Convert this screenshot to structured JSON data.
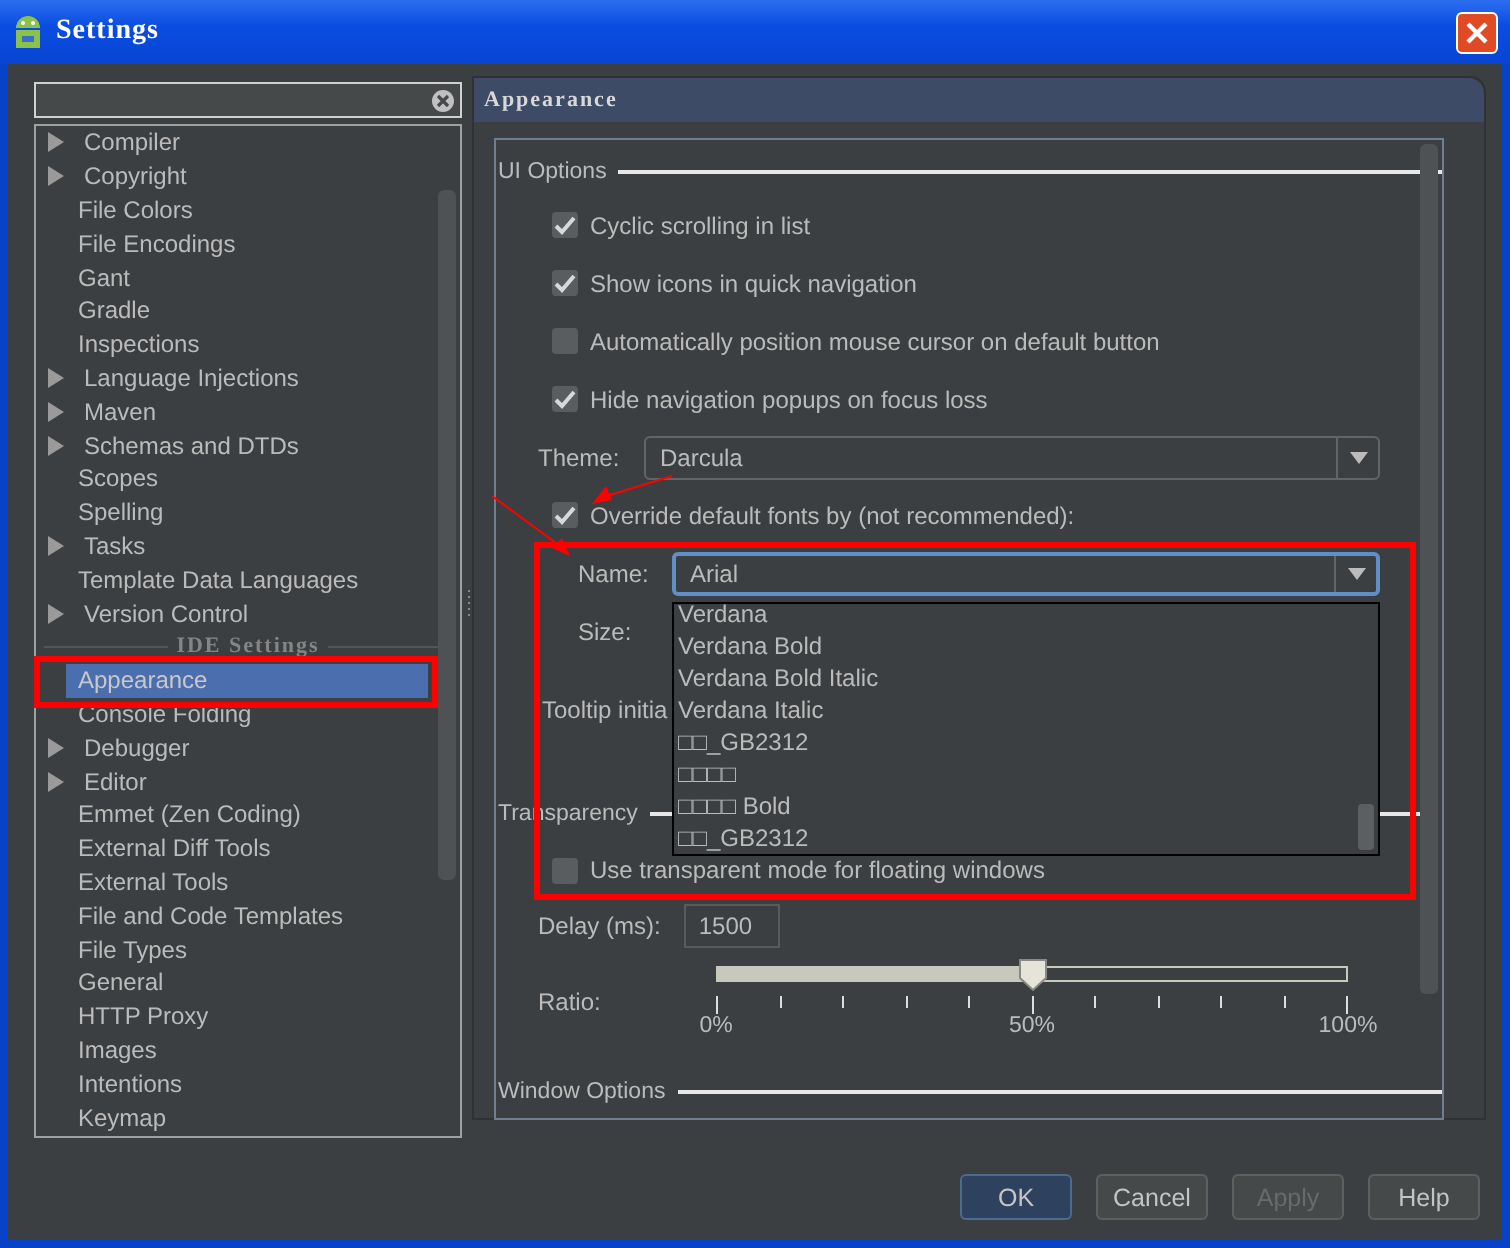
{
  "window": {
    "title": "Settings"
  },
  "tree": [
    {
      "kind": "node",
      "label": "Compiler",
      "selected": false
    },
    {
      "kind": "node",
      "label": "Copyright",
      "selected": false
    },
    {
      "kind": "leaf",
      "label": "File Colors",
      "selected": false
    },
    {
      "kind": "leaf",
      "label": "File Encodings",
      "selected": false
    },
    {
      "kind": "leaf",
      "label": "Gant",
      "selected": false
    },
    {
      "kind": "leaf",
      "label": "Gradle",
      "selected": false
    },
    {
      "kind": "leaf",
      "label": "Inspections",
      "selected": false
    },
    {
      "kind": "node",
      "label": "Language Injections",
      "selected": false
    },
    {
      "kind": "node",
      "label": "Maven",
      "selected": false
    },
    {
      "kind": "node",
      "label": "Schemas and DTDs",
      "selected": false
    },
    {
      "kind": "leaf",
      "label": "Scopes",
      "selected": false
    },
    {
      "kind": "leaf",
      "label": "Spelling",
      "selected": false
    },
    {
      "kind": "node",
      "label": "Tasks",
      "selected": false
    },
    {
      "kind": "leaf",
      "label": "Template Data Languages",
      "selected": false
    },
    {
      "kind": "node",
      "label": "Version Control",
      "selected": false
    },
    {
      "kind": "section",
      "label": "IDE Settings",
      "selected": false
    },
    {
      "kind": "leaf",
      "label": "Appearance",
      "selected": true
    },
    {
      "kind": "leaf",
      "label": "Console Folding",
      "selected": false
    },
    {
      "kind": "node",
      "label": "Debugger",
      "selected": false
    },
    {
      "kind": "node",
      "label": "Editor",
      "selected": false
    },
    {
      "kind": "leaf",
      "label": "Emmet (Zen Coding)",
      "selected": false
    },
    {
      "kind": "leaf",
      "label": "External Diff Tools",
      "selected": false
    },
    {
      "kind": "leaf",
      "label": "External Tools",
      "selected": false
    },
    {
      "kind": "leaf",
      "label": "File and Code Templates",
      "selected": false
    },
    {
      "kind": "leaf",
      "label": "File Types",
      "selected": false
    },
    {
      "kind": "leaf",
      "label": "General",
      "selected": false
    },
    {
      "kind": "leaf",
      "label": "HTTP Proxy",
      "selected": false
    },
    {
      "kind": "leaf",
      "label": "Images",
      "selected": false
    },
    {
      "kind": "leaf",
      "label": "Intentions",
      "selected": false
    },
    {
      "kind": "leaf",
      "label": "Keymap",
      "selected": false
    }
  ],
  "panel": {
    "title": "Appearance",
    "ui_options": {
      "title": "UI Options",
      "checkboxes": [
        {
          "label": "Cyclic scrolling in list",
          "checked": true
        },
        {
          "label": "Show icons in quick navigation",
          "checked": true
        },
        {
          "label": "Automatically position mouse cursor on default button",
          "checked": false
        },
        {
          "label": "Hide navigation popups on focus loss",
          "checked": true
        }
      ],
      "theme": {
        "label": "Theme:",
        "value": "Darcula"
      },
      "override": {
        "label": "Override default fonts by (not recommended):",
        "checked": true
      },
      "font_name": {
        "label": "Name:",
        "value": "Arial",
        "options": [
          "Verdana",
          "Verdana Bold",
          "Verdana Bold Italic",
          "Verdana Italic",
          "□□_GB2312",
          "□□□□",
          "□□□□ Bold",
          "□□_GB2312"
        ]
      },
      "size_label": "Size:",
      "tooltip_label": "Tooltip initia"
    },
    "transparency": {
      "title": "Transparency",
      "checkbox": {
        "label": "Use transparent mode for floating windows",
        "checked": false
      },
      "delay": {
        "label": "Delay (ms):",
        "value": "1500"
      },
      "ratio": {
        "label": "Ratio:",
        "level": 0.5,
        "tick_labels": [
          "0%",
          "50%",
          "100%"
        ]
      }
    },
    "window_options": {
      "title": "Window Options"
    }
  },
  "buttons": [
    {
      "label": "OK",
      "default": true,
      "disabled": false
    },
    {
      "label": "Cancel",
      "default": false,
      "disabled": false
    },
    {
      "label": "Apply",
      "default": false,
      "disabled": true
    },
    {
      "label": "Help",
      "default": false,
      "disabled": false
    }
  ]
}
